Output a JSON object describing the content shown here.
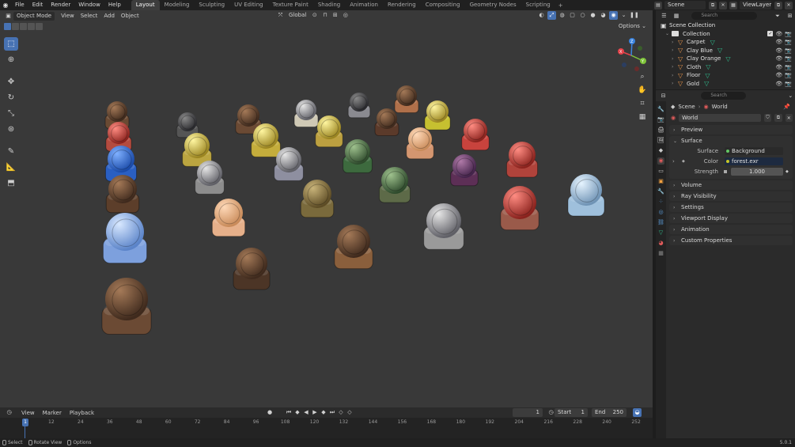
{
  "topbar": {
    "menu": [
      "File",
      "Edit",
      "Render",
      "Window",
      "Help"
    ],
    "workspaces": [
      "Layout",
      "Modeling",
      "Sculpting",
      "UV Editing",
      "Texture Paint",
      "Shading",
      "Animation",
      "Rendering",
      "Compositing",
      "Geometry Nodes",
      "Scripting"
    ],
    "active_workspace": "Layout",
    "add_tab": "+",
    "scene": "Scene",
    "view_layer": "ViewLayer"
  },
  "viewport": {
    "mode": "Object Mode",
    "menus": [
      "View",
      "Select",
      "Add",
      "Object"
    ],
    "orientation": "Global",
    "options": "Options",
    "axis_labels": {
      "x": "X",
      "y": "Y",
      "z": "Z"
    },
    "colors": {
      "accent": "#4772b3",
      "x_axis": "#e5424a",
      "y_axis": "#7fc43a",
      "z_axis": "#3b84e0"
    }
  },
  "timeline": {
    "menus": [
      "View",
      "Marker",
      "Playback"
    ],
    "current_frame": "1",
    "start_label": "Start",
    "start_value": "1",
    "end_label": "End",
    "end_value": "250",
    "playhead": "1",
    "ticks": [
      "12",
      "24",
      "36",
      "48",
      "60",
      "72",
      "84",
      "96",
      "108",
      "120",
      "132",
      "144",
      "156",
      "168",
      "180",
      "192",
      "204",
      "216",
      "228",
      "240",
      "252"
    ]
  },
  "statusbar": {
    "items": [
      "Select",
      "Rotate View",
      "Options"
    ],
    "version": "5.0.1"
  },
  "outliner": {
    "search_placeholder": "Search",
    "scene_collection": "Scene Collection",
    "collection": "Collection",
    "objects": [
      "Carpet",
      "Clay Blue",
      "Clay Orange",
      "Cloth",
      "Floor",
      "Gold"
    ]
  },
  "properties": {
    "search_placeholder": "Search",
    "breadcrumb_scene": "Scene",
    "breadcrumb_world": "World",
    "world_name": "World",
    "panels": {
      "preview": "Preview",
      "surface": "Surface",
      "volume": "Volume",
      "ray_visibility": "Ray Visibility",
      "settings": "Settings",
      "viewport_display": "Viewport Display",
      "animation": "Animation",
      "custom_properties": "Custom Properties"
    },
    "surface_label": "Surface",
    "surface_value": "Background",
    "color_label": "Color",
    "color_value": "forest.exr",
    "strength_label": "Strength",
    "strength_value": "1.000"
  }
}
